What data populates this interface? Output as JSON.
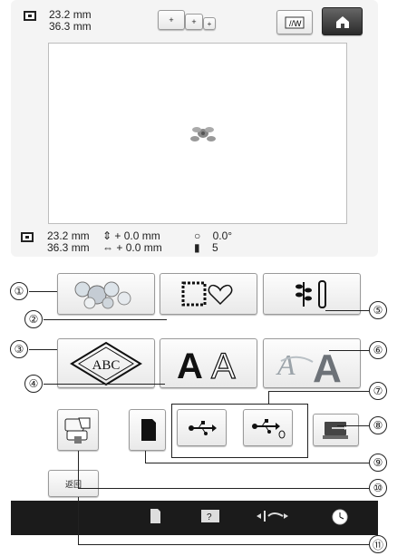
{
  "top_info": {
    "width_value": "23.2 mm",
    "height_value": "36.3 mm"
  },
  "hoop_sizes": [
    "+",
    "+",
    "+"
  ],
  "bottom_info": {
    "width_value": "23.2 mm",
    "height_value": "36.3 mm",
    "v_offset": "0.0 mm",
    "h_offset": "0.0 mm",
    "angle": "0.0°",
    "colors": "5"
  },
  "callouts": [
    "①",
    "②",
    "③",
    "④",
    "⑤",
    "⑥",
    "⑦",
    "⑧",
    "⑨",
    "⑩",
    "⑪"
  ],
  "back_button_label": "返回",
  "icons": {
    "home": "home-icon",
    "toggle": "toggle-icon",
    "usb": "usb-icon",
    "computer": "computer-usb-icon",
    "memory": "memory-card-icon"
  }
}
